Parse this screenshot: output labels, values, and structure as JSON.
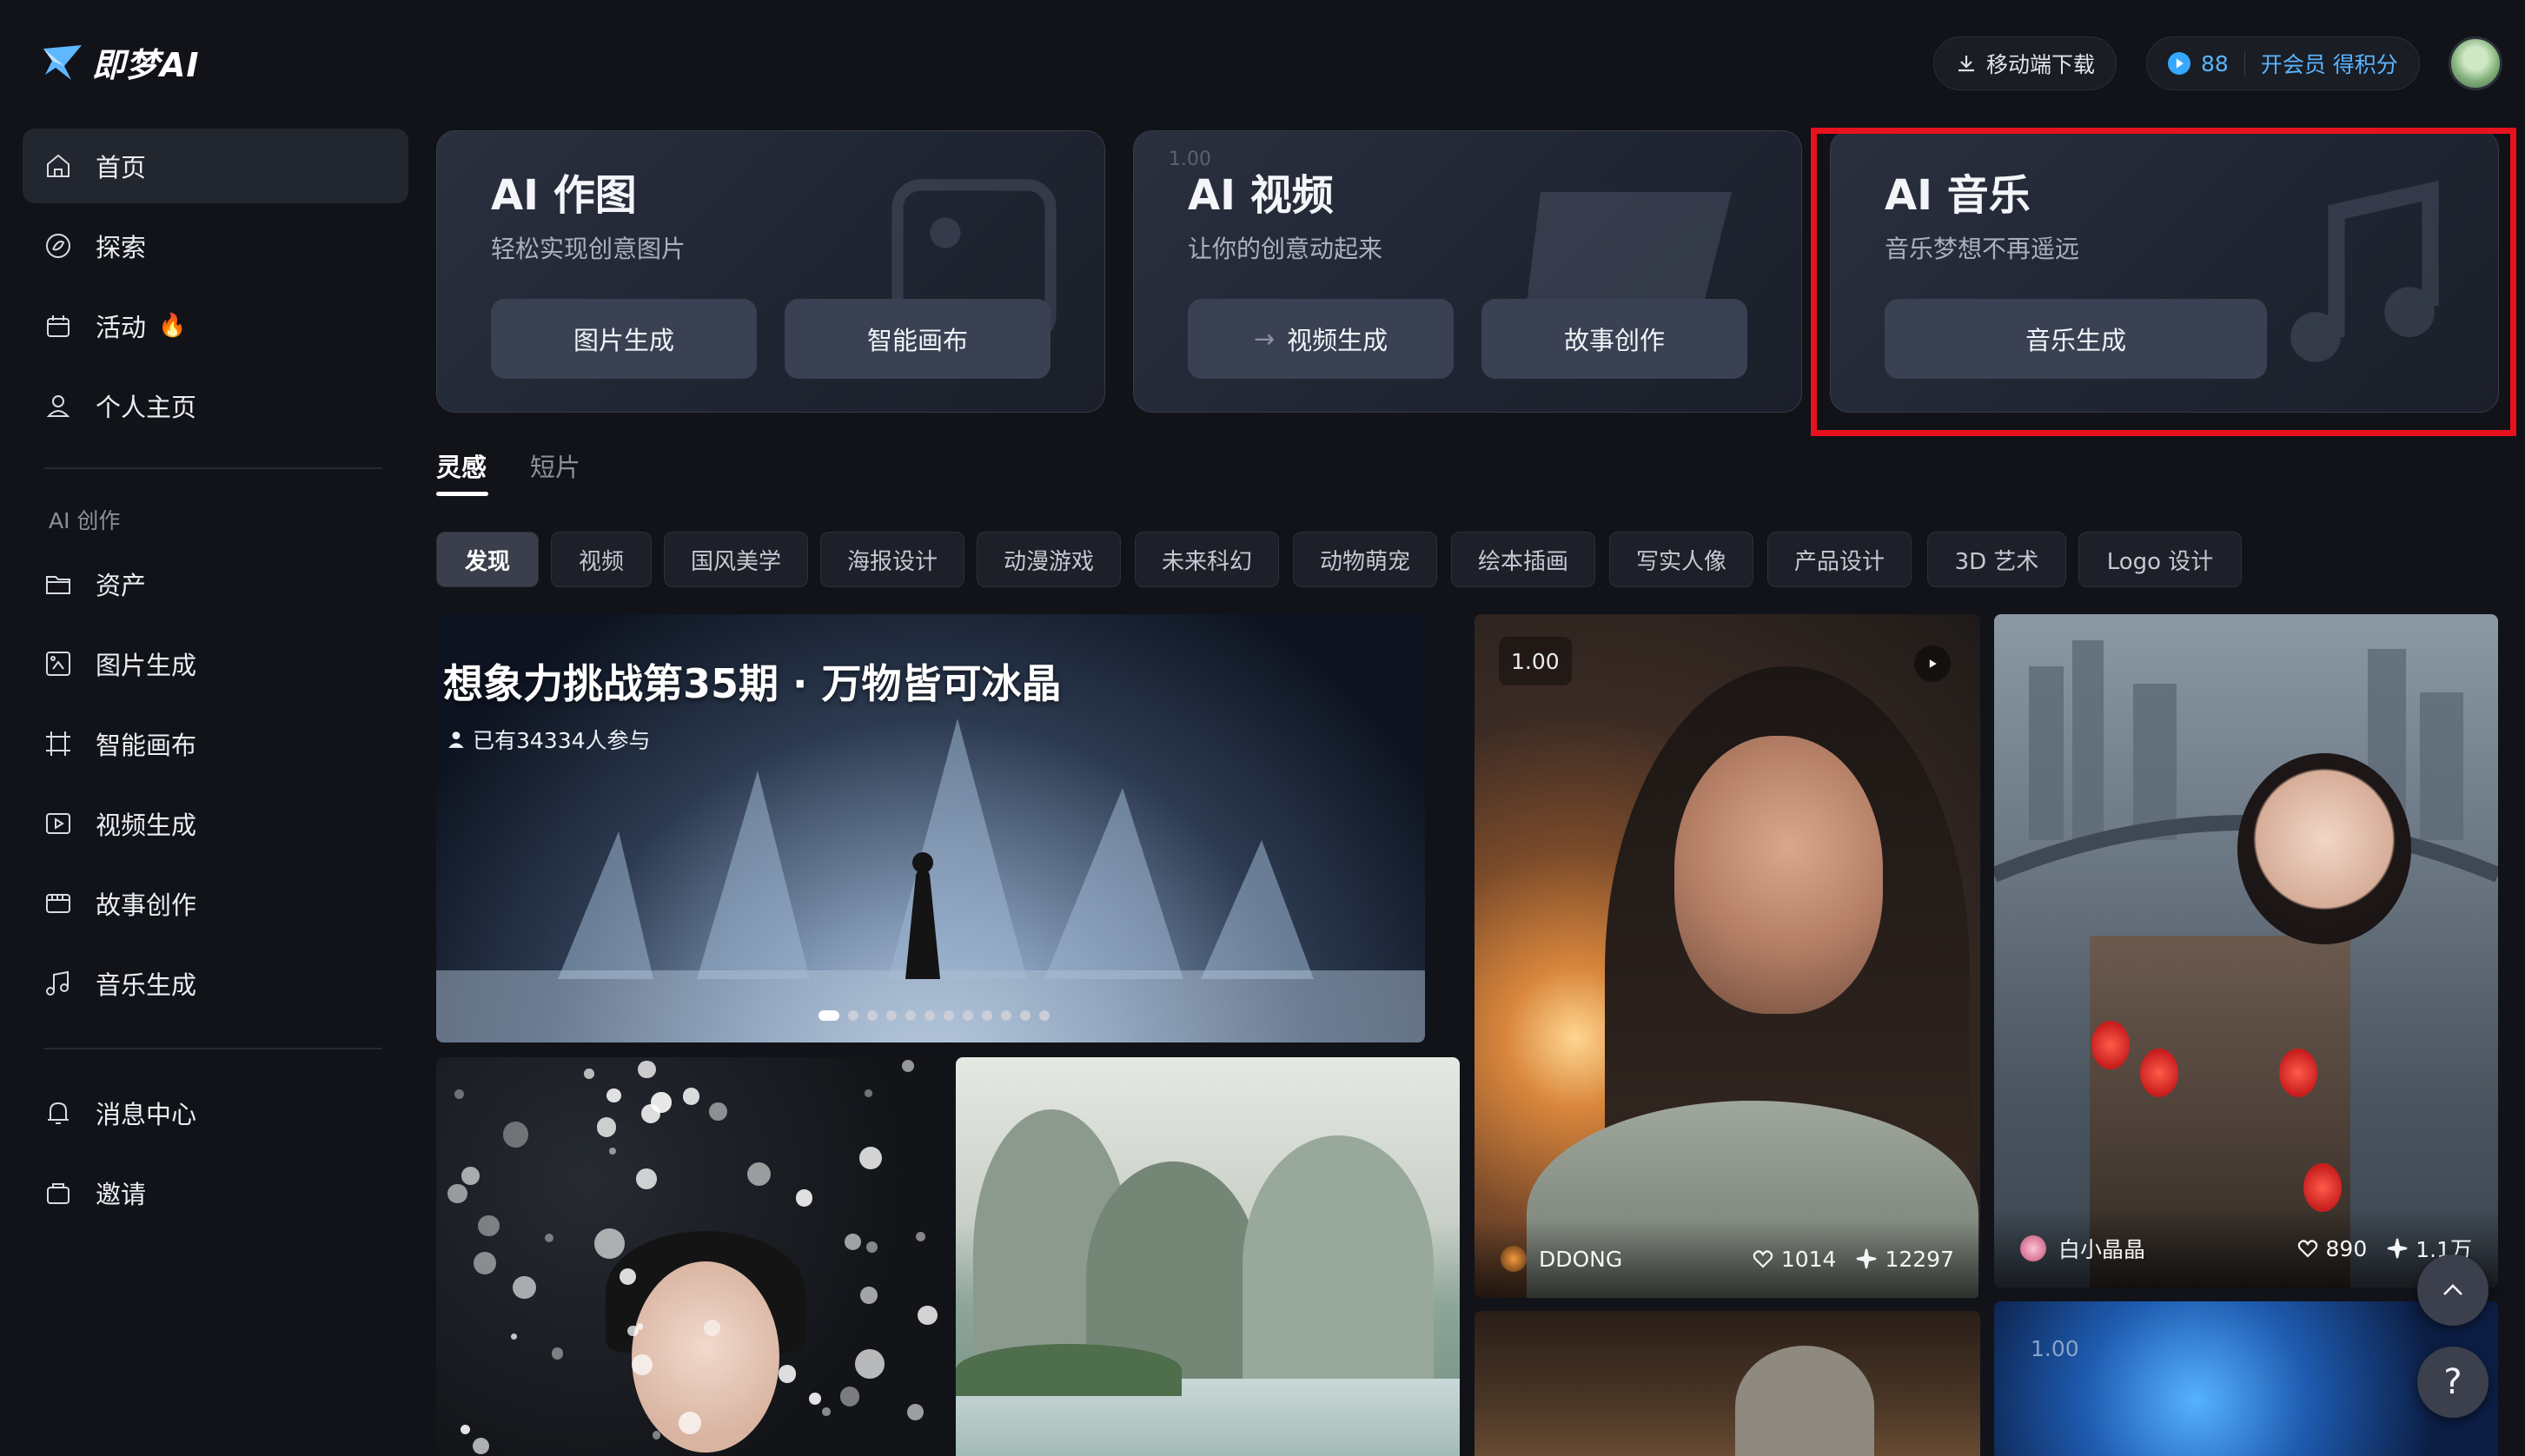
{
  "brand": {
    "name": "即梦AI"
  },
  "topbar": {
    "download_label": "移动端下载",
    "credits": "88",
    "member_cta": "开会员 得积分"
  },
  "sidebar": {
    "items": [
      {
        "label": "首页",
        "icon": "home-icon"
      },
      {
        "label": "探索",
        "icon": "explore-icon"
      },
      {
        "label": "活动",
        "icon": "activity-icon"
      },
      {
        "label": "个人主页",
        "icon": "user-icon"
      }
    ],
    "section_title": "AI 创作",
    "create_items": [
      {
        "label": "资产",
        "icon": "folder-icon"
      },
      {
        "label": "图片生成",
        "icon": "image-gen-icon"
      },
      {
        "label": "智能画布",
        "icon": "canvas-icon"
      },
      {
        "label": "视频生成",
        "icon": "video-gen-icon"
      },
      {
        "label": "故事创作",
        "icon": "story-icon"
      },
      {
        "label": "音乐生成",
        "icon": "music-icon"
      }
    ],
    "bottom_items": [
      {
        "label": "消息中心",
        "icon": "bell-icon"
      },
      {
        "label": "邀请",
        "icon": "invite-icon"
      }
    ]
  },
  "features": [
    {
      "title": "AI 作图",
      "subtitle": "轻松实现创意图片",
      "buttons": [
        "图片生成",
        "智能画布"
      ]
    },
    {
      "title": "AI 视频",
      "subtitle": "让你的创意动起来",
      "buttons": [
        "视频生成",
        "故事创作"
      ],
      "version": "1.00"
    },
    {
      "title": "AI 音乐",
      "subtitle": "音乐梦想不再遥远",
      "buttons": [
        "音乐生成"
      ]
    }
  ],
  "tabs": [
    "灵感",
    "短片"
  ],
  "categories": [
    "发现",
    "视频",
    "国风美学",
    "海报设计",
    "动漫游戏",
    "未来科幻",
    "动物萌宠",
    "绘本插画",
    "写实人像",
    "产品设计",
    "3D 艺术",
    "Logo 设计"
  ],
  "banner": {
    "title": "想象力挑战第35期 · 万物皆可冰晶",
    "participants": "已有34334人参与",
    "slide_count": 12,
    "active_slide": 1
  },
  "cards": [
    {
      "version": "1.00",
      "author": "DDONG",
      "likes": "1014",
      "uses": "12297"
    },
    {
      "author": "白小晶晶",
      "likes": "890",
      "uses": "1.1万"
    },
    {
      "version": "1.00"
    }
  ],
  "colors": {
    "accent": "#5ab4ff",
    "highlight": "#e8121e",
    "background": "#111319"
  }
}
